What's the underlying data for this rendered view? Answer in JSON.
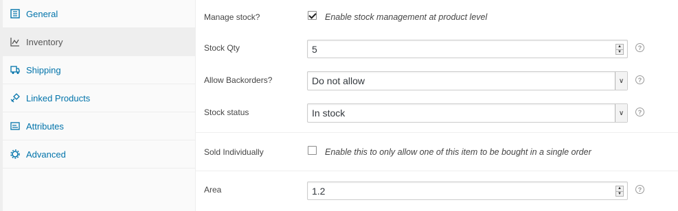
{
  "sidebar": {
    "items": [
      {
        "label": "General",
        "icon": "general-icon"
      },
      {
        "label": "Inventory",
        "icon": "inventory-icon",
        "active": true
      },
      {
        "label": "Shipping",
        "icon": "shipping-icon"
      },
      {
        "label": "Linked Products",
        "icon": "linked-products-icon"
      },
      {
        "label": "Attributes",
        "icon": "attributes-icon"
      },
      {
        "label": "Advanced",
        "icon": "advanced-icon"
      }
    ]
  },
  "fields": {
    "manage_stock": {
      "label": "Manage stock?",
      "checked": true,
      "description": "Enable stock management at product level"
    },
    "stock_qty": {
      "label": "Stock Qty",
      "value": "5"
    },
    "allow_backorders": {
      "label": "Allow Backorders?",
      "selected": "Do not allow"
    },
    "stock_status": {
      "label": "Stock status",
      "selected": "In stock"
    },
    "sold_individually": {
      "label": "Sold Individually",
      "checked": false,
      "description": "Enable this to only allow one of this item to be bought in a single order"
    },
    "area": {
      "label": "Area",
      "value": "1.2"
    }
  },
  "help_glyph": "?",
  "spinner": {
    "up": "▲",
    "down": "▼"
  },
  "select_arrow": "∨",
  "colors": {
    "link": "#0073aa",
    "active_bg": "#eeeeee",
    "sidebar_bg": "#fafafa"
  }
}
